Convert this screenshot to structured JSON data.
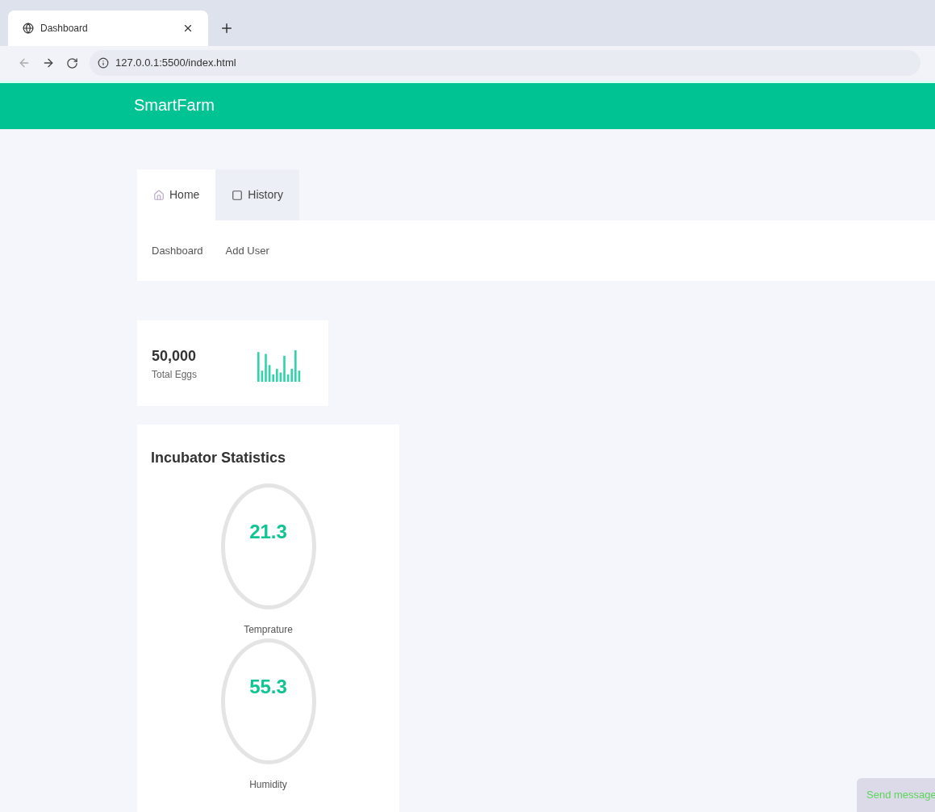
{
  "browser": {
    "tab_title": "Dashboard",
    "url": "127.0.0.1:5500/index.html"
  },
  "header": {
    "brand": "SmartFarm"
  },
  "tabs": [
    {
      "label": "Home",
      "kind": "home",
      "selected": true
    },
    {
      "label": "History",
      "kind": "history",
      "selected": false
    }
  ],
  "subnav": [
    "Dashboard",
    "Add User"
  ],
  "stat_card": {
    "value": "50,000",
    "label": "Total Eggs"
  },
  "incubator": {
    "title": "Incubator Statistics",
    "gauges": [
      {
        "value": "21.3",
        "label": "Temprature"
      },
      {
        "value": "55.3",
        "label": "Humidity"
      }
    ]
  },
  "chat_button": "Send message"
}
